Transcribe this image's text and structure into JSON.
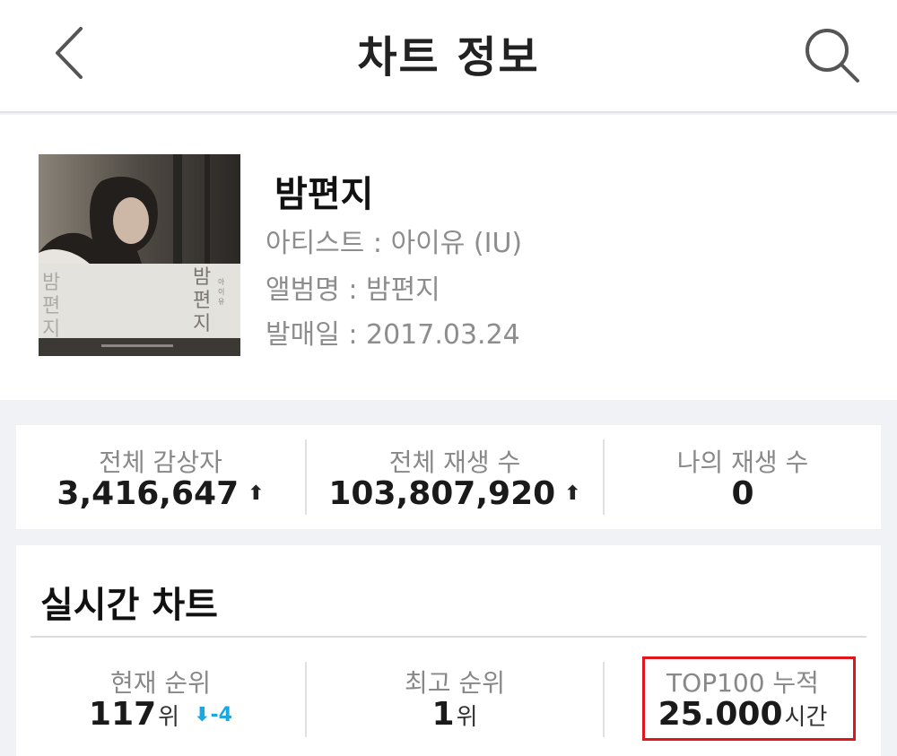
{
  "header": {
    "title": "차트 정보",
    "back_icon": "chevron-left-icon",
    "search_icon": "search-icon"
  },
  "song": {
    "title": "밤편지",
    "artist_line": "아티스트 : 아이유 (IU)",
    "album_line": "앨범명 : 밤편지",
    "release_line": "발매일 : 2017.03.24"
  },
  "stats": [
    {
      "label": "전체 감상자",
      "value": "3,416,647",
      "trend": "up"
    },
    {
      "label": "전체 재생 수",
      "value": "103,807,920",
      "trend": "up"
    },
    {
      "label": "나의 재생 수",
      "value": "0"
    }
  ],
  "realtime": {
    "title": "실시간 차트",
    "current_rank": {
      "label": "현재 순위",
      "value": "117",
      "unit": "위",
      "change": "-4",
      "change_direction": "down"
    },
    "best_rank": {
      "label": "최고 순위",
      "value": "1",
      "unit": "위"
    },
    "top100": {
      "label": "TOP100 누적",
      "value": "25.000",
      "unit": "시간",
      "highlighted": true
    }
  },
  "colors": {
    "accent_blue": "#18a9e3",
    "highlight_red": "#e0161b",
    "text_dark": "#1a1a1a",
    "text_muted": "#8d8d8d",
    "background": "#f1f2f5"
  }
}
